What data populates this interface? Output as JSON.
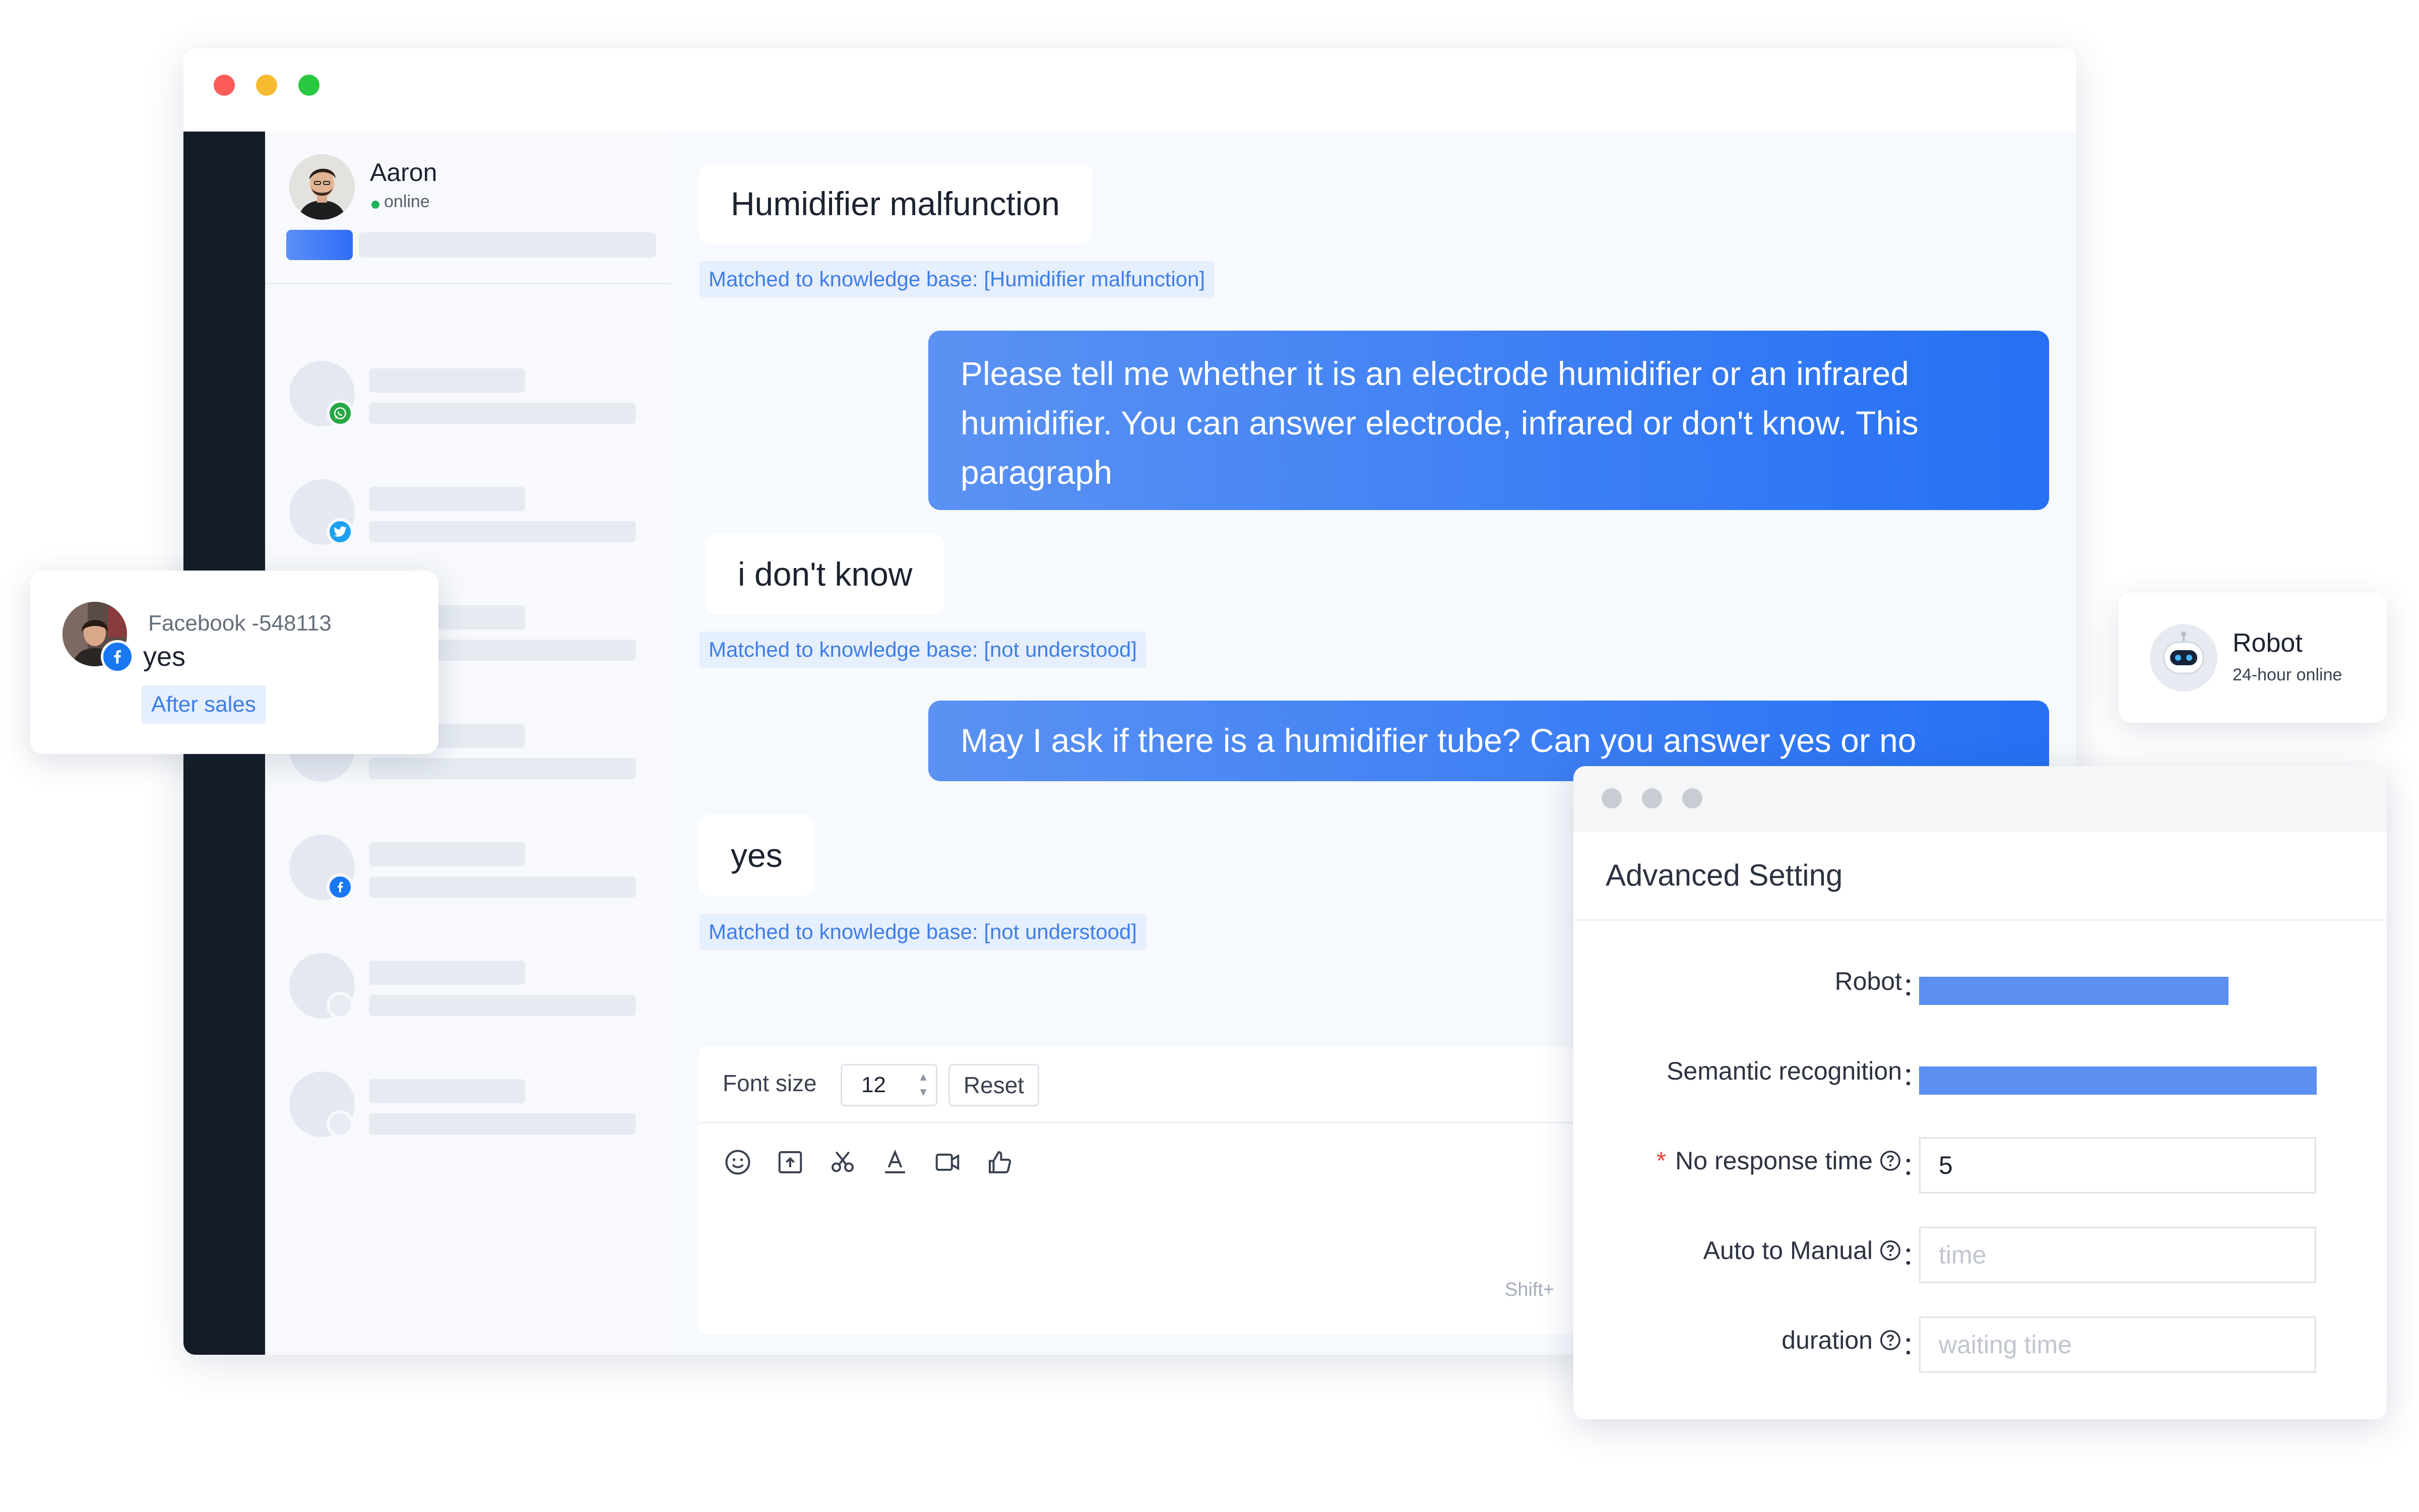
{
  "window": {
    "dots": [
      "#fb5c57",
      "#f6bb2e",
      "#2ac841"
    ]
  },
  "contacts": {
    "active": {
      "name": "Aaron",
      "status": "online"
    },
    "items": [
      {
        "channel": "whatsapp-icon",
        "color": "#25a744"
      },
      {
        "channel": "twitter-icon",
        "color": "#1da1f2"
      },
      {
        "channel": "facebook-icon",
        "color": "#1877f2"
      },
      {
        "channel": "none",
        "color": ""
      },
      {
        "channel": "none",
        "color": ""
      }
    ]
  },
  "chat": {
    "messages": [
      {
        "from": "customer",
        "text": "Humidifier malfunction",
        "kb": "Matched to knowledge base: [Humidifier malfunction]"
      },
      {
        "from": "agent",
        "text": "Please tell me whether it is an electrode humidifier or an infrared humidifier. You can answer electrode, infrared or don't know. This paragraph"
      },
      {
        "from": "customer",
        "text": "i don't know",
        "kb": "Matched to knowledge base: [not understood]"
      },
      {
        "from": "agent",
        "text": "May I ask if there is a humidifier tube? Can you answer yes or no"
      },
      {
        "from": "customer",
        "text": "yes",
        "kb": "Matched to knowledge base: [not understood]"
      }
    ]
  },
  "composer": {
    "font_size_label": "Font size",
    "font_size_value": "12",
    "reset_label": "Reset",
    "hint": "Shift+"
  },
  "fb_card": {
    "source": "Facebook -548113",
    "message": "yes",
    "tag": "After sales"
  },
  "robot_card": {
    "title": "Robot",
    "subtitle": "24-hour online"
  },
  "advanced": {
    "dots": [
      "#c8ccd3",
      "#c8ccd3",
      "#c8ccd3"
    ],
    "title": "Advanced Setting",
    "rows": {
      "robot": {
        "label": "Robot",
        "colon": "：",
        "fill_fraction": 0.156
      },
      "semantic": {
        "label": "Semantic recognition",
        "colon": "：",
        "fill_fraction": 0.326
      },
      "no_response": {
        "label": "No response time",
        "required_mark": "*",
        "colon": "：",
        "value": "5"
      },
      "auto_manual": {
        "label": "Auto to Manual",
        "colon": "：",
        "placeholder": "time"
      },
      "duration": {
        "label": "duration",
        "colon": "：",
        "placeholder": "waiting time"
      }
    }
  }
}
